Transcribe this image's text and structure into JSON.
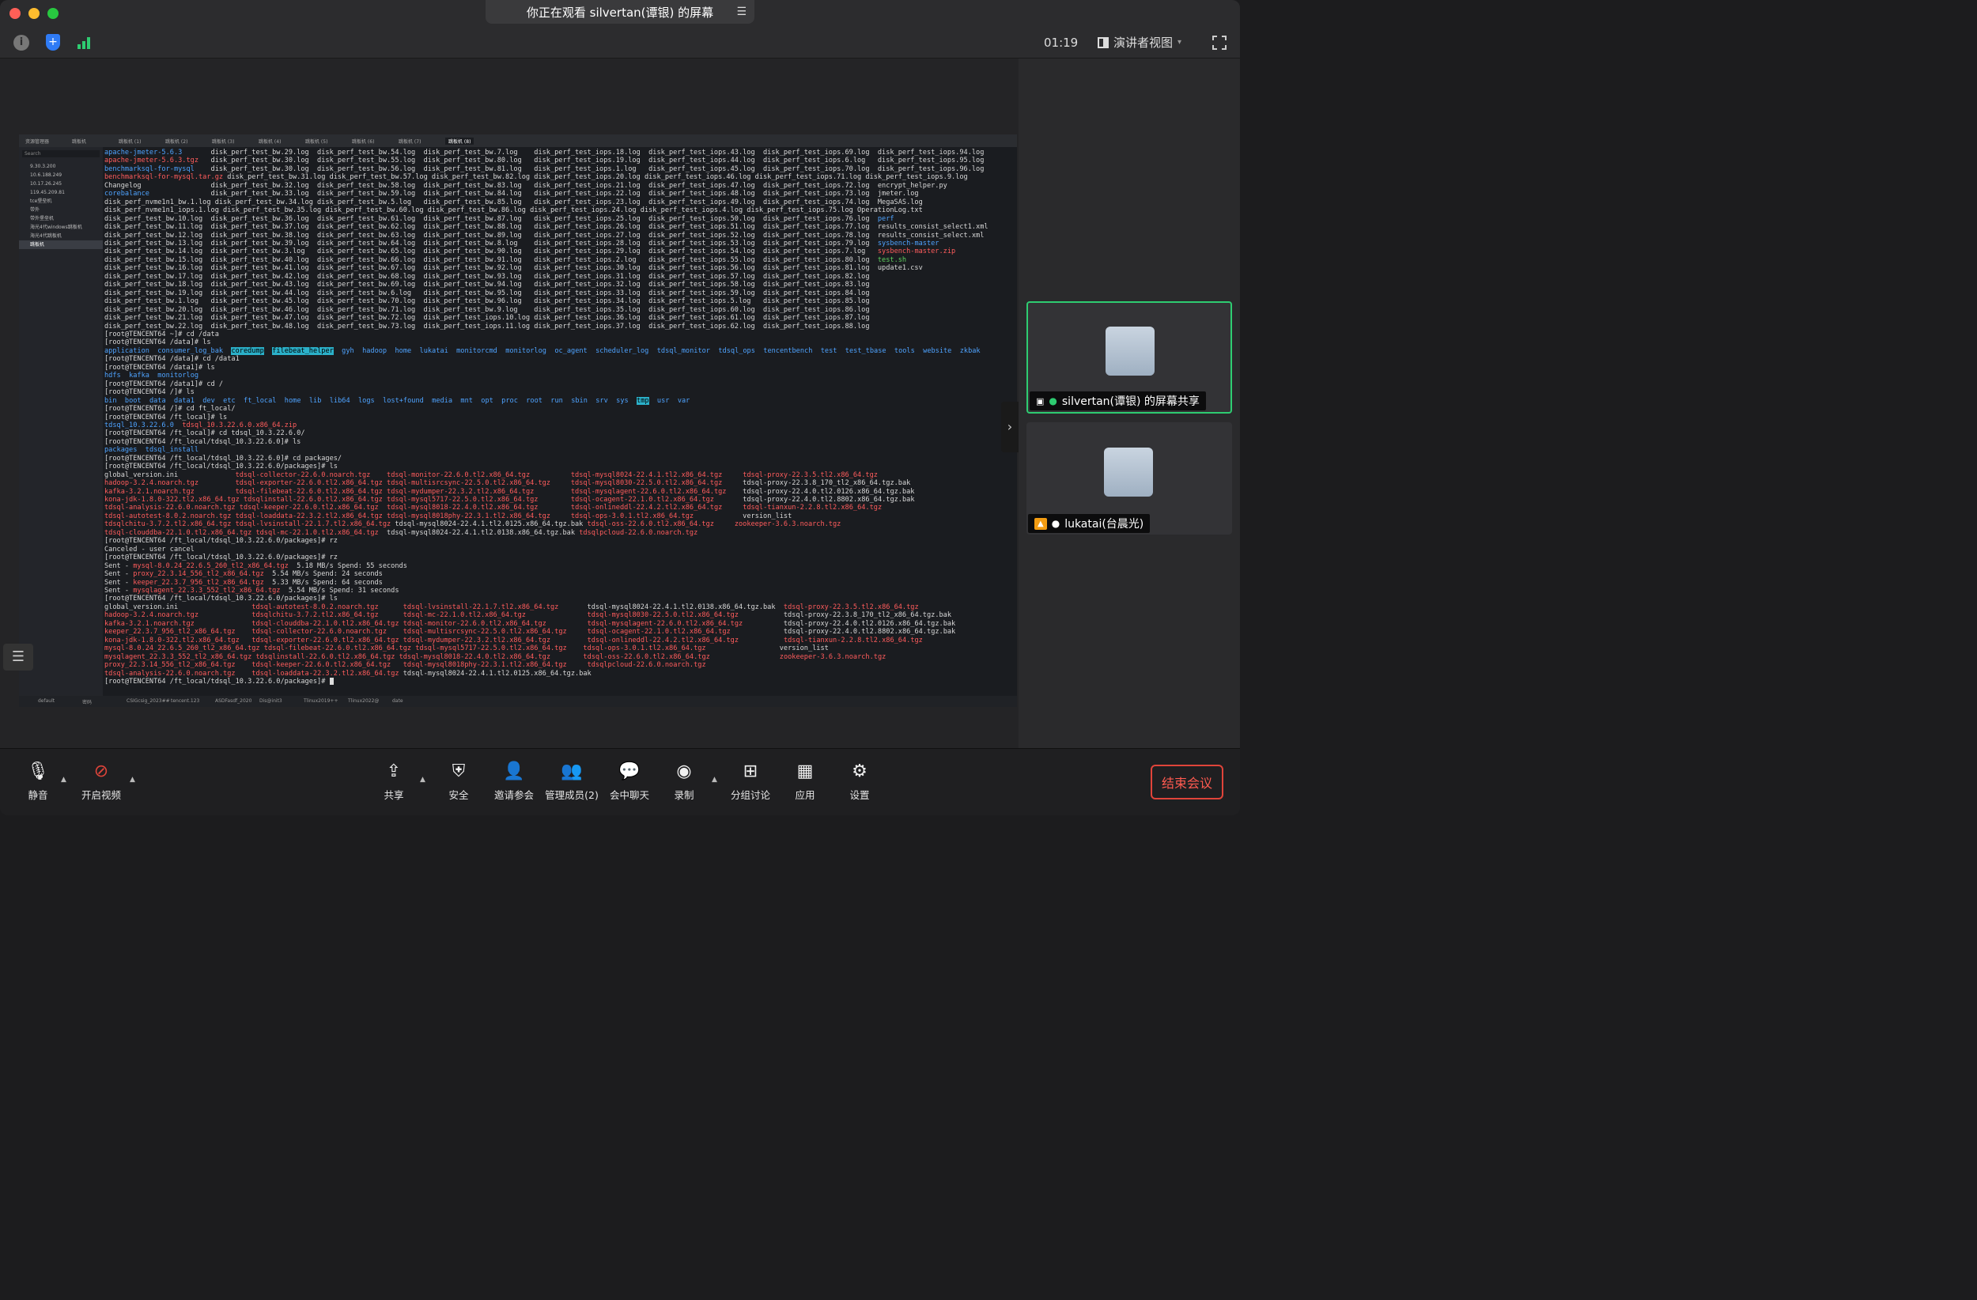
{
  "window": {
    "share_title": "你正在观看 silvertan(谭银) 的屏幕"
  },
  "infobar": {
    "timer": "01:19",
    "view_label": "演讲者视图"
  },
  "participants": [
    {
      "name": "silvertan(谭银) 的屏幕共享",
      "active": true
    },
    {
      "name": "lukatai(台晨光)",
      "active": false
    }
  ],
  "toolbar": {
    "mute": "静音",
    "video": "开启视频",
    "share": "共享",
    "security": "安全",
    "invite": "邀请参会",
    "manage": "管理成员(2)",
    "chat": "会中聊天",
    "record": "录制",
    "breakout": "分组讨论",
    "apps": "应用",
    "settings": "设置",
    "end": "结束会议"
  },
  "terminal": {
    "tabs": [
      "资源管理器",
      "跳板机",
      "跳板机 (1)",
      "跳板机 (2)",
      "跳板机 (3)",
      "跳板机 (4)",
      "跳板机 (5)",
      "跳板机 (6)",
      "跳板机 (7)",
      "跳板机 (8)"
    ],
    "sidebar_search": "Search",
    "hosts": [
      "9.30.3.200",
      "10.6.188.249",
      "10.17.26.245",
      "119.45.209.81",
      "tce堡垒机",
      "带外",
      "带外堡垒机",
      "海光4代windows跳板机",
      "海光4代跳板机",
      "跳板机"
    ],
    "status_items": [
      "default",
      "密码",
      "CSIGcsig_2023##",
      "tencent.123",
      "ASDFasdf_2020",
      "Dis@init3",
      "Tlinux2019++",
      "Tlinux2022@",
      "date"
    ],
    "lines": [
      "apache-jmeter-5.6.3       disk_perf_test_bw.29.log  disk_perf_test_bw.54.log  disk_perf_test_bw.7.log    disk_perf_test_iops.18.log  disk_perf_test_iops.43.log  disk_perf_test_iops.69.log  disk_perf_test_iops.94.log",
      "apache-jmeter-5.6.3.tgz   disk_perf_test_bw.30.log  disk_perf_test_bw.55.log  disk_perf_test_bw.80.log   disk_perf_test_iops.19.log  disk_perf_test_iops.44.log  disk_perf_test_iops.6.log   disk_perf_test_iops.95.log",
      "benchmarksql-for-mysql    disk_perf_test_bw.30.log  disk_perf_test_bw.56.log  disk_perf_test_bw.81.log   disk_perf_test_iops.1.log   disk_perf_test_iops.45.log  disk_perf_test_iops.70.log  disk_perf_test_iops.96.log",
      "benchmarksql-for-mysql.tar.gz disk_perf_test_bw.31.log disk_perf_test_bw.57.log disk_perf_test_bw.82.log disk_perf_test_iops.20.log disk_perf_test_iops.46.log disk_perf_test_iops.71.log disk_perf_test_iops.9.log",
      "Changelog                 disk_perf_test_bw.32.log  disk_perf_test_bw.58.log  disk_perf_test_bw.83.log   disk_perf_test_iops.21.log  disk_perf_test_iops.47.log  disk_perf_test_iops.72.log  encrypt_helper.py",
      "corebalance               disk_perf_test_bw.33.log  disk_perf_test_bw.59.log  disk_perf_test_bw.84.log   disk_perf_test_iops.22.log  disk_perf_test_iops.48.log  disk_perf_test_iops.73.log  jmeter.log",
      "disk_perf_nvme1n1_bw.1.log disk_perf_test_bw.34.log disk_perf_test_bw.5.log   disk_perf_test_bw.85.log   disk_perf_test_iops.23.log  disk_perf_test_iops.49.log  disk_perf_test_iops.74.log  MegaSAS.log",
      "disk_perf_nvme1n1_iops.1.log disk_perf_test_bw.35.log disk_perf_test_bw.60.log disk_perf_test_bw.86.log disk_perf_test_iops.24.log disk_perf_test_iops.4.log disk_perf_test_iops.75.log OperationLog.txt",
      "disk_perf_test_bw.10.log  disk_perf_test_bw.36.log  disk_perf_test_bw.61.log  disk_perf_test_bw.87.log   disk_perf_test_iops.25.log  disk_perf_test_iops.50.log  disk_perf_test_iops.76.log  perf",
      "disk_perf_test_bw.11.log  disk_perf_test_bw.37.log  disk_perf_test_bw.62.log  disk_perf_test_bw.88.log   disk_perf_test_iops.26.log  disk_perf_test_iops.51.log  disk_perf_test_iops.77.log  results_consist_select1.xml",
      "disk_perf_test_bw.12.log  disk_perf_test_bw.38.log  disk_perf_test_bw.63.log  disk_perf_test_bw.89.log   disk_perf_test_iops.27.log  disk_perf_test_iops.52.log  disk_perf_test_iops.78.log  results_consist_select.xml",
      "disk_perf_test_bw.13.log  disk_perf_test_bw.39.log  disk_perf_test_bw.64.log  disk_perf_test_bw.8.log    disk_perf_test_iops.28.log  disk_perf_test_iops.53.log  disk_perf_test_iops.79.log  sysbench-master",
      "disk_perf_test_bw.14.log  disk_perf_test_bw.3.log   disk_perf_test_bw.65.log  disk_perf_test_bw.90.log   disk_perf_test_iops.29.log  disk_perf_test_iops.54.log  disk_perf_test_iops.7.log   sysbench-master.zip",
      "disk_perf_test_bw.15.log  disk_perf_test_bw.40.log  disk_perf_test_bw.66.log  disk_perf_test_bw.91.log   disk_perf_test_iops.2.log   disk_perf_test_iops.55.log  disk_perf_test_iops.80.log  test.sh",
      "disk_perf_test_bw.16.log  disk_perf_test_bw.41.log  disk_perf_test_bw.67.log  disk_perf_test_bw.92.log   disk_perf_test_iops.30.log  disk_perf_test_iops.56.log  disk_perf_test_iops.81.log  update1.csv",
      "disk_perf_test_bw.17.log  disk_perf_test_bw.42.log  disk_perf_test_bw.68.log  disk_perf_test_bw.93.log   disk_perf_test_iops.31.log  disk_perf_test_iops.57.log  disk_perf_test_iops.82.log",
      "disk_perf_test_bw.18.log  disk_perf_test_bw.43.log  disk_perf_test_bw.69.log  disk_perf_test_bw.94.log   disk_perf_test_iops.32.log  disk_perf_test_iops.58.log  disk_perf_test_iops.83.log",
      "disk_perf_test_bw.19.log  disk_perf_test_bw.44.log  disk_perf_test_bw.6.log   disk_perf_test_bw.95.log   disk_perf_test_iops.33.log  disk_perf_test_iops.59.log  disk_perf_test_iops.84.log",
      "disk_perf_test_bw.1.log   disk_perf_test_bw.45.log  disk_perf_test_bw.70.log  disk_perf_test_bw.96.log   disk_perf_test_iops.34.log  disk_perf_test_iops.5.log   disk_perf_test_iops.85.log",
      "disk_perf_test_bw.20.log  disk_perf_test_bw.46.log  disk_perf_test_bw.71.log  disk_perf_test_bw.9.log    disk_perf_test_iops.35.log  disk_perf_test_iops.60.log  disk_perf_test_iops.86.log",
      "disk_perf_test_bw.21.log  disk_perf_test_bw.47.log  disk_perf_test_bw.72.log  disk_perf_test_iops.10.log disk_perf_test_iops.36.log  disk_perf_test_iops.61.log  disk_perf_test_iops.87.log",
      "disk_perf_test_bw.22.log  disk_perf_test_bw.48.log  disk_perf_test_bw.73.log  disk_perf_test_iops.11.log disk_perf_test_iops.37.log  disk_perf_test_iops.62.log  disk_perf_test_iops.88.log",
      "[root@TENCENT64 ~]# cd /data",
      "[root@TENCENT64 /data]# ls",
      "application  consumer_log_bak  coredump  filebeat_helper  gyh  hadoop  home  lukatai  monitorcmd  monitorlog  oc_agent  scheduler_log  tdsql_monitor  tdsql_ops  tencentbench  test  test_tbase  tools  website  zkbak",
      "[root@TENCENT64 /data]# cd /data1",
      "[root@TENCENT64 /data1]# ls",
      "hdfs  kafka  monitorlog",
      "[root@TENCENT64 /data1]# cd /",
      "[root@TENCENT64 /]# ls",
      "bin  boot  data  data1  dev  etc  ft_local  home  lib  lib64  logs  lost+found  media  mnt  opt  proc  root  run  sbin  srv  sys  tmp  usr  var",
      "[root@TENCENT64 /]# cd ft_local/",
      "[root@TENCENT64 /ft_local]# ls",
      "tdsql_10.3.22.6.0  tdsql_10.3.22.6.0.x86_64.zip",
      "[root@TENCENT64 /ft_local]# cd tdsql_10.3.22.6.0/",
      "[root@TENCENT64 /ft_local/tdsql_10.3.22.6.0]# ls",
      "packages  tdsql_install",
      "[root@TENCENT64 /ft_local/tdsql_10.3.22.6.0]# cd packages/",
      "[root@TENCENT64 /ft_local/tdsql_10.3.22.6.0/packages]# ls",
      "global_version.ini              tdsql-collector-22.6.0.noarch.tgz    tdsql-monitor-22.6.0.tl2.x86_64.tgz          tdsql-mysql8024-22.4.1.tl2.x86_64.tgz     tdsql-proxy-22.3.5.tl2.x86_64.tgz",
      "hadoop-3.2.4.noarch.tgz         tdsql-exporter-22.6.0.tl2.x86_64.tgz tdsql-multisrcsync-22.5.0.tl2.x86_64.tgz     tdsql-mysql8030-22.5.0.tl2.x86_64.tgz     tdsql-proxy-22.3.8_170_tl2_x86_64.tgz.bak",
      "kafka-3.2.1.noarch.tgz          tdsql-filebeat-22.6.0.tl2.x86_64.tgz tdsql-mydumper-22.3.2.tl2.x86_64.tgz         tdsql-mysqlagent-22.6.0.tl2.x86_64.tgz    tdsql-proxy-22.4.0.tl2.0126.x86_64.tgz.bak",
      "kona-jdk-1.8.0-322.tl2.x86_64.tgz tdsqlinstall-22.6.0.tl2.x86_64.tgz tdsql-mysql5717-22.5.0.tl2.x86_64.tgz        tdsql-ocagent-22.1.0.tl2.x86_64.tgz       tdsql-proxy-22.4.0.tl2.8802.x86_64.tgz.bak",
      "tdsql-analysis-22.6.0.noarch.tgz tdsql-keeper-22.6.0.tl2.x86_64.tgz  tdsql-mysql8018-22.4.0.tl2.x86_64.tgz        tdsql-onlineddl-22.4.2.tl2.x86_64.tgz     tdsql-tianxun-2.2.8.tl2.x86_64.tgz",
      "tdsql-autotest-8.0.2.noarch.tgz tdsql-loaddata-22.3.2.tl2.x86_64.tgz tdsql-mysql8018phy-22.3.1.tl2.x86_64.tgz     tdsql-ops-3.0.1.tl2.x86_64.tgz            version_list",
      "tdsqlchitu-3.7.2.tl2.x86_64.tgz tdsql-lvsinstall-22.1.7.tl2.x86_64.tgz tdsql-mysql8024-22.4.1.tl2.0125.x86_64.tgz.bak tdsql-oss-22.6.0.tl2.x86_64.tgz     zookeeper-3.6.3.noarch.tgz",
      "tdsql-clouddba-22.1.0.tl2.x86_64.tgz tdsql-mc-22.1.0.tl2.x86_64.tgz  tdsql-mysql8024-22.4.1.tl2.0138.x86_64.tgz.bak tdsqlpcloud-22.6.0.noarch.tgz",
      "[root@TENCENT64 /ft_local/tdsql_10.3.22.6.0/packages]# rz",
      "Canceled - user cancel",
      "[root@TENCENT64 /ft_local/tdsql_10.3.22.6.0/packages]# rz",
      "Sent - mysql-8.0.24_22.6.5_260_tl2_x86_64.tgz  5.18 MB/s Spend: 55 seconds",
      "Sent - proxy_22.3.14_556_tl2_x86_64.tgz  5.54 MB/s Spend: 24 seconds",
      "Sent - keeper_22.3.7_956_tl2_x86_64.tgz  5.33 MB/s Spend: 64 seconds",
      "Sent - mysqlagent_22.3.3_552_tl2_x86_64.tgz  5.54 MB/s Spend: 31 seconds",
      "[root@TENCENT64 /ft_local/tdsql_10.3.22.6.0/packages]# ls",
      "global_version.ini                  tdsql-autotest-8.0.2.noarch.tgz      tdsql-lvsinstall-22.1.7.tl2.x86_64.tgz       tdsql-mysql8024-22.4.1.tl2.0138.x86_64.tgz.bak  tdsql-proxy-22.3.5.tl2.x86_64.tgz",
      "hadoop-3.2.4.noarch.tgz             tdsqlchitu-3.7.2.tl2.x86_64.tgz      tdsql-mc-22.1.0.tl2.x86_64.tgz               tdsql-mysql8030-22.5.0.tl2.x86_64.tgz           tdsql-proxy-22.3.8_170_tl2_x86_64.tgz.bak",
      "kafka-3.2.1.noarch.tgz              tdsql-clouddba-22.1.0.tl2.x86_64.tgz tdsql-monitor-22.6.0.tl2.x86_64.tgz          tdsql-mysqlagent-22.6.0.tl2.x86_64.tgz          tdsql-proxy-22.4.0.tl2.0126.x86_64.tgz.bak",
      "keeper_22.3.7_956_tl2_x86_64.tgz    tdsql-collector-22.6.0.noarch.tgz    tdsql-multisrcsync-22.5.0.tl2.x86_64.tgz     tdsql-ocagent-22.1.0.tl2.x86_64.tgz             tdsql-proxy-22.4.0.tl2.8802.x86_64.tgz.bak",
      "kona-jdk-1.8.0-322.tl2.x86_64.tgz   tdsql-exporter-22.6.0.tl2.x86_64.tgz tdsql-mydumper-22.3.2.tl2.x86_64.tgz         tdsql-onlineddl-22.4.2.tl2.x86_64.tgz           tdsql-tianxun-2.2.8.tl2.x86_64.tgz",
      "mysql-8.0.24_22.6.5_260_tl2_x86_64.tgz tdsql-filebeat-22.6.0.tl2.x86_64.tgz tdsql-mysql5717-22.5.0.tl2.x86_64.tgz    tdsql-ops-3.0.1.tl2.x86_64.tgz                  version_list",
      "mysqlagent_22.3.3_552_tl2_x86_64.tgz tdsqlinstall-22.6.0.tl2.x86_64.tgz tdsql-mysql8018-22.4.0.tl2.x86_64.tgz        tdsql-oss-22.6.0.tl2.x86_64.tgz                 zookeeper-3.6.3.noarch.tgz",
      "proxy_22.3.14_556_tl2_x86_64.tgz    tdsql-keeper-22.6.0.tl2.x86_64.tgz   tdsql-mysql8018phy-22.3.1.tl2.x86_64.tgz     tdsqlpcloud-22.6.0.noarch.tgz",
      "tdsql-analysis-22.6.0.noarch.tgz    tdsql-loaddata-22.3.2.tl2.x86_64.tgz tdsql-mysql8024-22.4.1.tl2.0125.x86_64.tgz.bak",
      "[root@TENCENT64 /ft_local/tdsql_10.3.22.6.0/packages]# "
    ]
  },
  "colors": {
    "accent_green": "#2ecc71",
    "end_red": "#e0443a",
    "dir_blue": "#4ea3ff",
    "archive_red": "#ff5c5c"
  }
}
